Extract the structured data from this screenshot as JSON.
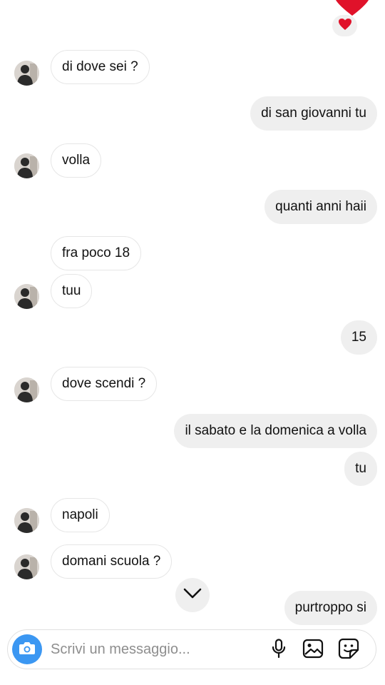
{
  "reactions": {
    "big_heart": "heart-icon",
    "small_heart": "heart-reaction-icon"
  },
  "messages": [
    {
      "side": "in",
      "text": "di dove sei ?"
    },
    {
      "side": "out",
      "text": "di san giovanni tu"
    },
    {
      "side": "in",
      "text": "volla"
    },
    {
      "side": "out",
      "text": "quanti anni haii"
    },
    {
      "side": "in",
      "text": "fra poco 18"
    },
    {
      "side": "in",
      "text": "tuu"
    },
    {
      "side": "out",
      "text": "15"
    },
    {
      "side": "in",
      "text": "dove scendi ?"
    },
    {
      "side": "out",
      "text": "il sabato e la domenica a volla"
    },
    {
      "side": "out",
      "text": "tu"
    },
    {
      "side": "in",
      "text": "napoli"
    },
    {
      "side": "in",
      "text": "domani scuola ?"
    },
    {
      "side": "out",
      "text": "purtroppo si"
    }
  ],
  "composer": {
    "placeholder": "Scrivi un messaggio...",
    "icons": [
      "camera-icon",
      "microphone-icon",
      "gallery-icon",
      "sticker-icon"
    ]
  },
  "colors": {
    "accent": "#3b97f2",
    "heart": "#e0122a",
    "outgoing_bubble": "#efefef"
  }
}
